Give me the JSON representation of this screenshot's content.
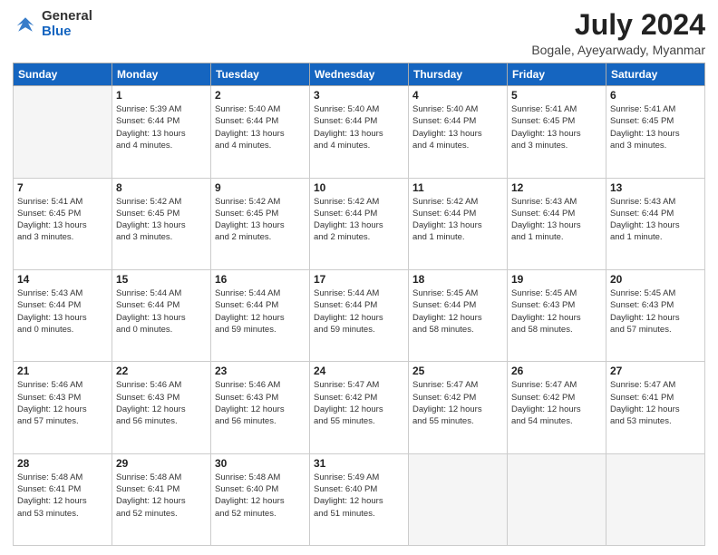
{
  "logo": {
    "general": "General",
    "blue": "Blue"
  },
  "title": "July 2024",
  "location": "Bogale, Ayeyarwady, Myanmar",
  "header_days": [
    "Sunday",
    "Monday",
    "Tuesday",
    "Wednesday",
    "Thursday",
    "Friday",
    "Saturday"
  ],
  "weeks": [
    [
      {
        "day": "",
        "info": ""
      },
      {
        "day": "1",
        "info": "Sunrise: 5:39 AM\nSunset: 6:44 PM\nDaylight: 13 hours\nand 4 minutes."
      },
      {
        "day": "2",
        "info": "Sunrise: 5:40 AM\nSunset: 6:44 PM\nDaylight: 13 hours\nand 4 minutes."
      },
      {
        "day": "3",
        "info": "Sunrise: 5:40 AM\nSunset: 6:44 PM\nDaylight: 13 hours\nand 4 minutes."
      },
      {
        "day": "4",
        "info": "Sunrise: 5:40 AM\nSunset: 6:44 PM\nDaylight: 13 hours\nand 4 minutes."
      },
      {
        "day": "5",
        "info": "Sunrise: 5:41 AM\nSunset: 6:45 PM\nDaylight: 13 hours\nand 3 minutes."
      },
      {
        "day": "6",
        "info": "Sunrise: 5:41 AM\nSunset: 6:45 PM\nDaylight: 13 hours\nand 3 minutes."
      }
    ],
    [
      {
        "day": "7",
        "info": "Sunrise: 5:41 AM\nSunset: 6:45 PM\nDaylight: 13 hours\nand 3 minutes."
      },
      {
        "day": "8",
        "info": "Sunrise: 5:42 AM\nSunset: 6:45 PM\nDaylight: 13 hours\nand 3 minutes."
      },
      {
        "day": "9",
        "info": "Sunrise: 5:42 AM\nSunset: 6:45 PM\nDaylight: 13 hours\nand 2 minutes."
      },
      {
        "day": "10",
        "info": "Sunrise: 5:42 AM\nSunset: 6:44 PM\nDaylight: 13 hours\nand 2 minutes."
      },
      {
        "day": "11",
        "info": "Sunrise: 5:42 AM\nSunset: 6:44 PM\nDaylight: 13 hours\nand 1 minute."
      },
      {
        "day": "12",
        "info": "Sunrise: 5:43 AM\nSunset: 6:44 PM\nDaylight: 13 hours\nand 1 minute."
      },
      {
        "day": "13",
        "info": "Sunrise: 5:43 AM\nSunset: 6:44 PM\nDaylight: 13 hours\nand 1 minute."
      }
    ],
    [
      {
        "day": "14",
        "info": "Sunrise: 5:43 AM\nSunset: 6:44 PM\nDaylight: 13 hours\nand 0 minutes."
      },
      {
        "day": "15",
        "info": "Sunrise: 5:44 AM\nSunset: 6:44 PM\nDaylight: 13 hours\nand 0 minutes."
      },
      {
        "day": "16",
        "info": "Sunrise: 5:44 AM\nSunset: 6:44 PM\nDaylight: 12 hours\nand 59 minutes."
      },
      {
        "day": "17",
        "info": "Sunrise: 5:44 AM\nSunset: 6:44 PM\nDaylight: 12 hours\nand 59 minutes."
      },
      {
        "day": "18",
        "info": "Sunrise: 5:45 AM\nSunset: 6:44 PM\nDaylight: 12 hours\nand 58 minutes."
      },
      {
        "day": "19",
        "info": "Sunrise: 5:45 AM\nSunset: 6:43 PM\nDaylight: 12 hours\nand 58 minutes."
      },
      {
        "day": "20",
        "info": "Sunrise: 5:45 AM\nSunset: 6:43 PM\nDaylight: 12 hours\nand 57 minutes."
      }
    ],
    [
      {
        "day": "21",
        "info": "Sunrise: 5:46 AM\nSunset: 6:43 PM\nDaylight: 12 hours\nand 57 minutes."
      },
      {
        "day": "22",
        "info": "Sunrise: 5:46 AM\nSunset: 6:43 PM\nDaylight: 12 hours\nand 56 minutes."
      },
      {
        "day": "23",
        "info": "Sunrise: 5:46 AM\nSunset: 6:43 PM\nDaylight: 12 hours\nand 56 minutes."
      },
      {
        "day": "24",
        "info": "Sunrise: 5:47 AM\nSunset: 6:42 PM\nDaylight: 12 hours\nand 55 minutes."
      },
      {
        "day": "25",
        "info": "Sunrise: 5:47 AM\nSunset: 6:42 PM\nDaylight: 12 hours\nand 55 minutes."
      },
      {
        "day": "26",
        "info": "Sunrise: 5:47 AM\nSunset: 6:42 PM\nDaylight: 12 hours\nand 54 minutes."
      },
      {
        "day": "27",
        "info": "Sunrise: 5:47 AM\nSunset: 6:41 PM\nDaylight: 12 hours\nand 53 minutes."
      }
    ],
    [
      {
        "day": "28",
        "info": "Sunrise: 5:48 AM\nSunset: 6:41 PM\nDaylight: 12 hours\nand 53 minutes."
      },
      {
        "day": "29",
        "info": "Sunrise: 5:48 AM\nSunset: 6:41 PM\nDaylight: 12 hours\nand 52 minutes."
      },
      {
        "day": "30",
        "info": "Sunrise: 5:48 AM\nSunset: 6:40 PM\nDaylight: 12 hours\nand 52 minutes."
      },
      {
        "day": "31",
        "info": "Sunrise: 5:49 AM\nSunset: 6:40 PM\nDaylight: 12 hours\nand 51 minutes."
      },
      {
        "day": "",
        "info": ""
      },
      {
        "day": "",
        "info": ""
      },
      {
        "day": "",
        "info": ""
      }
    ]
  ]
}
